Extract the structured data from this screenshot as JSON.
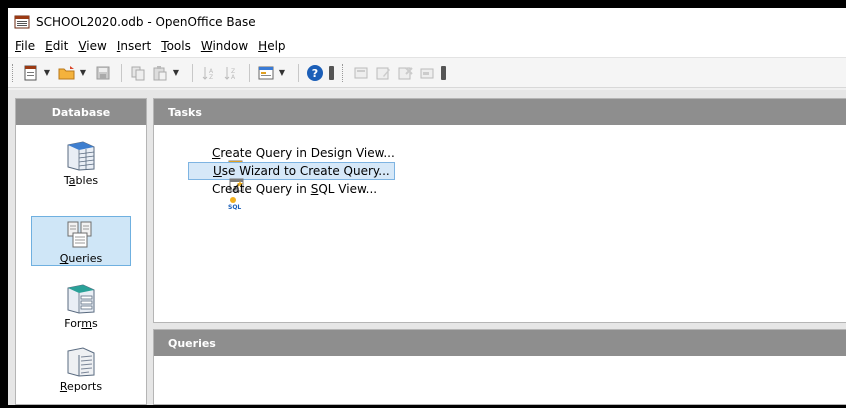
{
  "window": {
    "title": "SCHOOL2020.odb - OpenOffice Base",
    "icon": "openoffice-base-icon"
  },
  "menubar": {
    "items": [
      {
        "pre": "",
        "key": "F",
        "post": "ile"
      },
      {
        "pre": "",
        "key": "E",
        "post": "dit"
      },
      {
        "pre": "",
        "key": "V",
        "post": "iew"
      },
      {
        "pre": "",
        "key": "I",
        "post": "nsert"
      },
      {
        "pre": "",
        "key": "T",
        "post": "ools"
      },
      {
        "pre": "",
        "key": "W",
        "post": "indow"
      },
      {
        "pre": "",
        "key": "H",
        "post": "elp"
      }
    ]
  },
  "toolbar": {
    "icons": [
      "new-document-icon",
      "open-folder-icon",
      "save-icon",
      "copy-icon",
      "paste-icon",
      "sort-ascending-icon",
      "sort-descending-icon",
      "form-icon",
      "help-icon",
      "open-db-object-icon",
      "edit-icon",
      "delete-icon",
      "rename-icon"
    ]
  },
  "database": {
    "heading": "Database",
    "items": [
      {
        "pre": "T",
        "key": "a",
        "post": "bles",
        "icon": "tables-icon"
      },
      {
        "pre": "",
        "key": "Q",
        "post": "ueries",
        "icon": "queries-icon",
        "selected": true
      },
      {
        "pre": "For",
        "key": "m",
        "post": "s",
        "icon": "forms-icon"
      },
      {
        "pre": "",
        "key": "R",
        "post": "eports",
        "icon": "reports-icon"
      }
    ]
  },
  "tasks": {
    "heading": "Tasks",
    "items": [
      {
        "pre": "",
        "key": "C",
        "post": "reate Query in Design View...",
        "icon": "design-view-icon"
      },
      {
        "pre": "",
        "key": "U",
        "post": "se Wizard to Create Query...",
        "icon": "wizard-icon",
        "selected": true
      },
      {
        "pre": "Create Query in ",
        "key": "S",
        "post": "QL View...",
        "icon": "sql-icon"
      }
    ]
  },
  "queries": {
    "heading": "Queries"
  },
  "colors": {
    "panel_header": "#8e8e8e",
    "selection_bg": "#cfe6f7",
    "selection_border": "#6fb0e0"
  }
}
